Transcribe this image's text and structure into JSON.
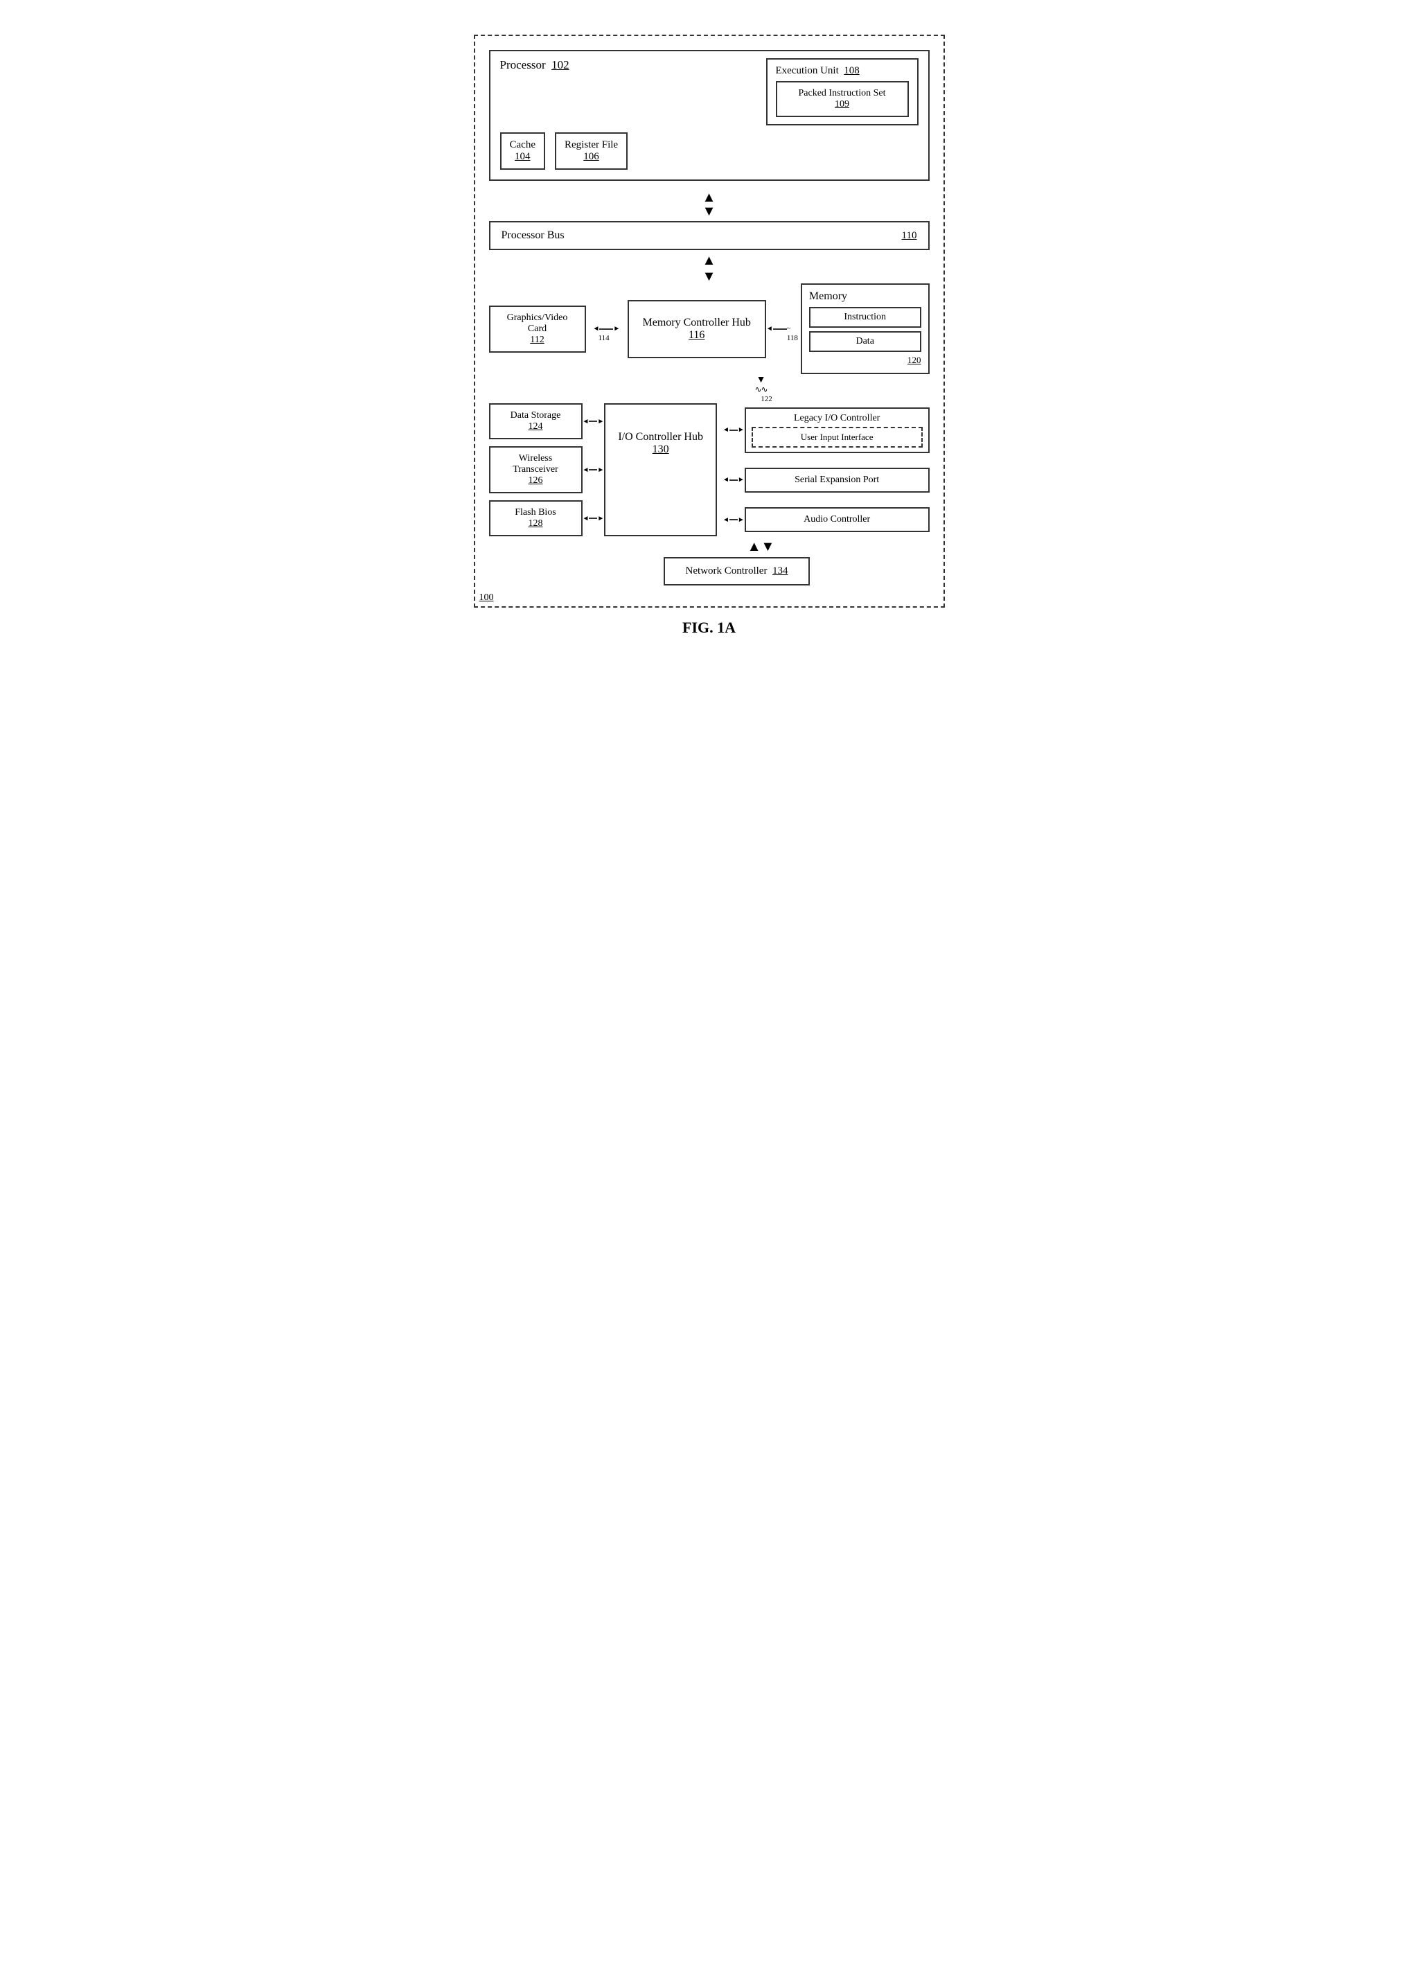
{
  "title": "FIG. 1A",
  "diagram": {
    "outer_ref": "100",
    "processor": {
      "label": "Processor",
      "ref": "102",
      "cache": {
        "label": "Cache",
        "ref": "104"
      },
      "register_file": {
        "label": "Register File",
        "ref": "106"
      },
      "execution_unit": {
        "label": "Execution Unit",
        "ref": "108",
        "packed_instruction": {
          "label": "Packed Instruction Set",
          "ref": "109"
        }
      }
    },
    "processor_bus": {
      "label": "Processor Bus",
      "ref": "110"
    },
    "graphics_video": {
      "label": "Graphics/Video Card",
      "ref": "112"
    },
    "bus_label": "114",
    "mch": {
      "label": "Memory Controller Hub",
      "ref": "116"
    },
    "mch_right_label": "118",
    "memory": {
      "label": "Memory",
      "ref": "120",
      "instruction": {
        "label": "Instruction"
      },
      "data": {
        "label": "Data"
      }
    },
    "wavy_label": "122",
    "data_storage": {
      "label": "Data Storage",
      "ref": "124"
    },
    "wireless": {
      "label": "Wireless Transceiver",
      "ref": "126"
    },
    "flash_bios": {
      "label": "Flash Bios",
      "ref": "128"
    },
    "ioch": {
      "label": "I/O Controller Hub",
      "ref": "130"
    },
    "legacy_io": {
      "label": "Legacy I/O Controller",
      "user_input": {
        "label": "User Input Interface"
      }
    },
    "serial_expansion": {
      "label": "Serial Expansion Port"
    },
    "audio": {
      "label": "Audio Controller"
    },
    "network": {
      "label": "Network Controller",
      "ref": "134"
    }
  }
}
